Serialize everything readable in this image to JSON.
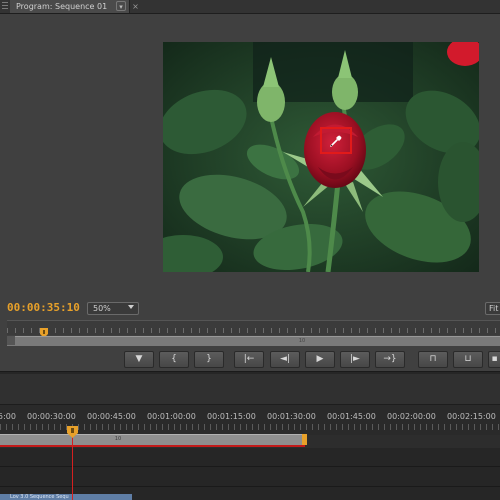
{
  "monitor": {
    "tab_title": "Program: Sequence 01",
    "tab_menu_icon": "chevron-down-icon",
    "tab_close_icon": "close-icon",
    "timecode": "00:00:35:10",
    "zoom_value": "50%",
    "fit_value": "Fit",
    "mini_track_label": "10",
    "accent_color": "#e8a12a",
    "picker_color": "#e21a1a"
  },
  "transport": [
    {
      "name": "add-marker-button",
      "icon": "marker-icon",
      "glyph": "▼"
    },
    {
      "name": "mark-in-button",
      "icon": "mark-in-icon",
      "glyph": "{"
    },
    {
      "name": "mark-out-button",
      "icon": "mark-out-icon",
      "glyph": "}"
    },
    {
      "name": "go-to-in-button",
      "icon": "go-to-in-icon",
      "glyph": "|←"
    },
    {
      "name": "step-back-button",
      "icon": "step-back-icon",
      "glyph": "◄|"
    },
    {
      "name": "play-button",
      "icon": "play-icon",
      "glyph": "▶"
    },
    {
      "name": "step-forward-button",
      "icon": "step-forward-icon",
      "glyph": "|►"
    },
    {
      "name": "go-to-out-button",
      "icon": "go-to-out-icon",
      "glyph": "→}"
    },
    {
      "name": "lift-button",
      "icon": "lift-icon",
      "glyph": "⊓"
    },
    {
      "name": "extract-button",
      "icon": "extract-icon",
      "glyph": "⊔"
    },
    {
      "name": "export-frame-button",
      "icon": "camera-icon",
      "glyph": "▪"
    }
  ],
  "timeline": {
    "ruler_labels": [
      "5:00",
      "00:00:30:00",
      "00:00:45:00",
      "00:01:00:00",
      "00:01:15:00",
      "00:01:30:00",
      "00:01:45:00",
      "00:02:00:00",
      "00:02:15:00"
    ],
    "work_area_label": "10",
    "clip_label": "Lov 3.0 Sequence Sequ"
  }
}
